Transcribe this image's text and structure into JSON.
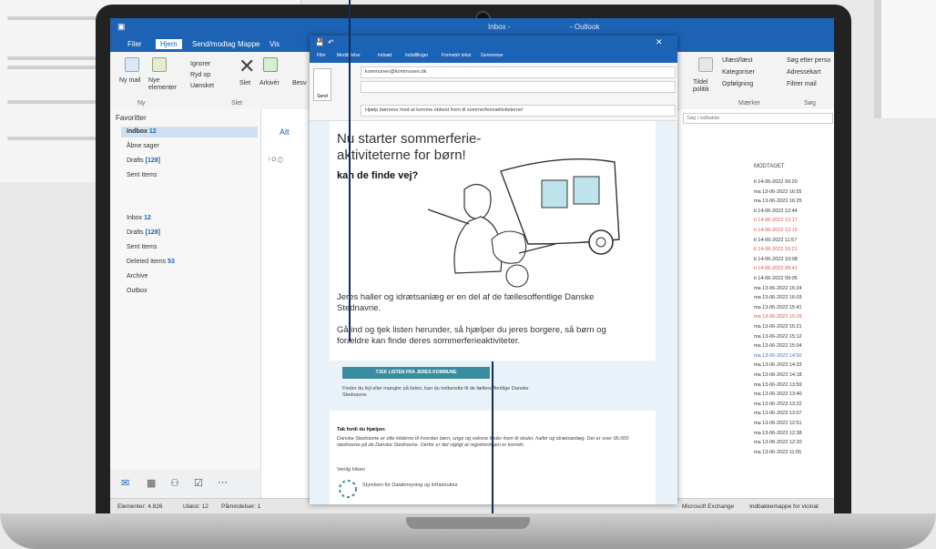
{
  "outlook": {
    "window_title": "Inbox -",
    "app_name": "- Outlook",
    "tabs": [
      "Filer",
      "Hjem",
      "Send/modtag",
      "Mappe",
      "Vis"
    ],
    "ribbon": {
      "new_mail": "Ny mail",
      "new_items": "Nye elementer",
      "new_group": "Ny",
      "ignore": "Ignorer",
      "cleanup": "Ryd op",
      "junk": "Uønsket",
      "delete": "Slet",
      "archive": "Arkivér",
      "reply": "Besv",
      "delete_group": "Slet",
      "tags_unread": "Ulæst/læst",
      "tags_categorize": "Kategoriser",
      "tags_followup": "Opfølgning",
      "tags_group": "Mærker",
      "search_people": "Søg efter perso",
      "address_book": "Adressekart",
      "filter_email": "Filtrer mail",
      "search_group": "Søg",
      "policy": "Tildel politik"
    },
    "favorites_header": "Favoritter",
    "favorites": [
      {
        "label": "Indbox",
        "count": "12"
      },
      {
        "label": "Åbne sager",
        "count": ""
      },
      {
        "label": "Drafts",
        "count": "[128]"
      },
      {
        "label": "Sent Items",
        "count": ""
      }
    ],
    "folders": [
      {
        "label": "Inbox",
        "count": "12"
      },
      {
        "label": "Drafts",
        "count": "[128]"
      },
      {
        "label": "Sent Items",
        "count": ""
      },
      {
        "label": "Deleted Items",
        "count": "53"
      },
      {
        "label": "Archive",
        "count": ""
      },
      {
        "label": "Outbox",
        "count": ""
      }
    ],
    "list_tab": "Alt",
    "list_header": "! ⭘ ⓘ",
    "search_placeholder": "Søg i indbakke",
    "col_received": "MODTAGET",
    "rows": [
      {
        "t": "ti 14-06-2022 09:20",
        "c": "dark"
      },
      {
        "t": "ma 13-06-2022 16:55",
        "c": "dark"
      },
      {
        "t": "ma 13-06-2022 16:25",
        "c": "dark"
      },
      {
        "t": "ti 14-06-2022 12:44",
        "c": "dark"
      },
      {
        "t": "ti 14-06-2022 12:17",
        "c": "red"
      },
      {
        "t": "ti 14-06-2022 12:15",
        "c": "red"
      },
      {
        "t": "ti 14-06-2022 11:57",
        "c": "dark"
      },
      {
        "t": "ti 14-06-2022 10:21",
        "c": "red"
      },
      {
        "t": "ti 14-06-2022 10:08",
        "c": "dark"
      },
      {
        "t": "ti 14-06-2022 09:41",
        "c": "red"
      },
      {
        "t": "ti 14-06-2022 09:05",
        "c": "dark"
      },
      {
        "t": "ma 13-06-2022 16:24",
        "c": "dark"
      },
      {
        "t": "ma 13-06-2022 16:03",
        "c": "dark"
      },
      {
        "t": "ma 13-06-2022 15:41",
        "c": "dark"
      },
      {
        "t": "ma 13-06-2022 15:29",
        "c": "red"
      },
      {
        "t": "ma 13-06-2022 15:21",
        "c": "dark"
      },
      {
        "t": "ma 13-06-2022 15:12",
        "c": "dark"
      },
      {
        "t": "ma 13-06-2022 15:04",
        "c": "dark"
      },
      {
        "t": "ma 13-06-2022 14:50",
        "c": "blue"
      },
      {
        "t": "ma 13-06-2022 14:33",
        "c": "dark"
      },
      {
        "t": "ma 13-06-2022 14:18",
        "c": "dark"
      },
      {
        "t": "ma 13-06-2022 13:59",
        "c": "dark"
      },
      {
        "t": "ma 13-06-2022 13:40",
        "c": "dark"
      },
      {
        "t": "ma 13-06-2022 13:22",
        "c": "dark"
      },
      {
        "t": "ma 13-06-2022 13:07",
        "c": "dark"
      },
      {
        "t": "ma 13-06-2022 12:51",
        "c": "dark"
      },
      {
        "t": "ma 13-06-2022 12:38",
        "c": "dark"
      },
      {
        "t": "ma 13-06-2022 12:20",
        "c": "dark"
      },
      {
        "t": "ma 13-06-2022 11:55",
        "c": "dark"
      }
    ],
    "status_items": "Elementer: 4.826",
    "status_unread": "Ulæst: 12",
    "status_reminders": "Påmindelser: 1",
    "status_connection": "Microsoft Exchange",
    "status_folders": "Indbakkemappe for vicinat"
  },
  "compose": {
    "tabs": [
      "Filer",
      "Meddelelse",
      "Indsæt",
      "Indstillinger",
      "Formatér tekst",
      "Gennemse"
    ],
    "send_label": "Send",
    "to": "kommunen@kommunen.dk",
    "subject": "Hjælp børnene med at komme ebbest frem til sommerferieaktiviteterne!",
    "headline": "Nu starter sommerferie-aktiviteterne for børn!",
    "subheadline": "kan de finde vej?",
    "para1": "Jeres haller og idrætsanlæg er en del af de fællesoffentlige Danske Stednavne.",
    "para2": "Gå ind og tjek listen herunder, så hjælper du jeres borgere, så børn og forældre kan finde deres sommerferieaktiviteter.",
    "cta_button": "TJEK LISTEN FRA JERES KOMMUNE",
    "cta_text": "Finder du fejl eller mangler på listen, kan du indberette til de fællesoffentlige Danske Stednavne.",
    "thanks_title": "Tak fordi du hjælper.",
    "thanks_text": "Danske Stednavne er ofte kilderne til hvordan børn, unge og voksne finder frem til skoler, haller og idrætsanlæg. Der er over 95.000 stednavne på de Danske Stednavne. Derfor er det vigtigt at registreringen er korrekt.",
    "regards": "Venlig hilsen",
    "org": "Styrelsen for Dataforsyning og Infrastruktur"
  }
}
